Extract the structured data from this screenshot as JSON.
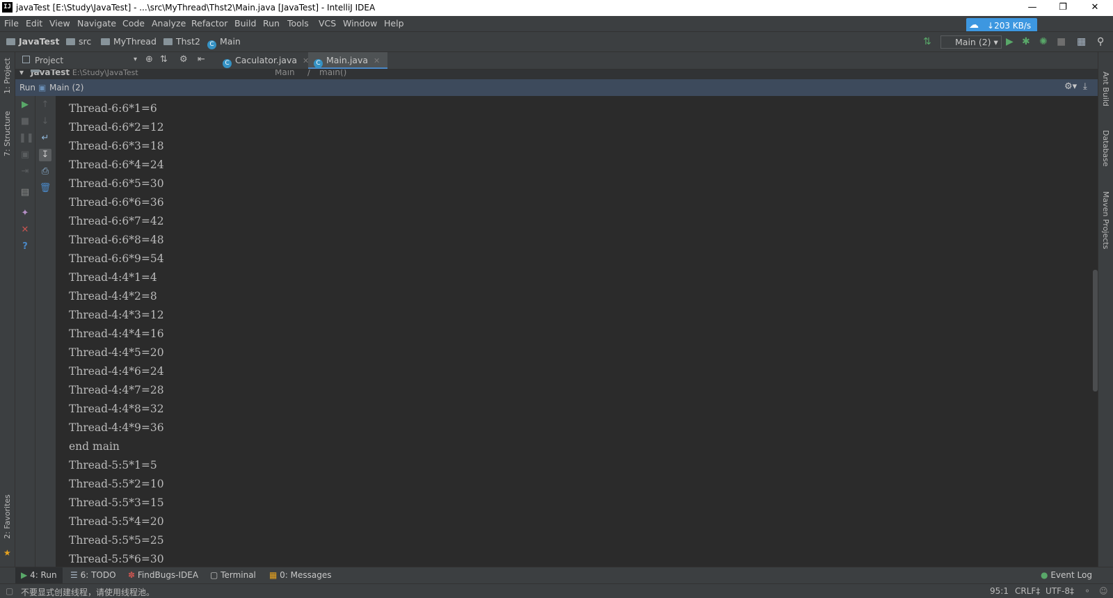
{
  "window": {
    "title": "javaTest [E:\\Study\\JavaTest] - ...\\src\\MyThread\\Thst2\\Main.java [JavaTest] - IntelliJ IDEA",
    "logo": "IJ",
    "controls": {
      "minimize_icon": "minimize-icon",
      "restore_icon": "restore-icon",
      "close_icon": "close-icon"
    }
  },
  "menu": [
    "File",
    "Edit",
    "View",
    "Navigate",
    "Code",
    "Analyze",
    "Refactor",
    "Build",
    "Run",
    "Tools",
    "VCS",
    "Window",
    "Help"
  ],
  "net_speed": {
    "value": "203 KB/s",
    "color": "#3d97e0"
  },
  "breadcrumb": [
    {
      "label": "JavaTest",
      "icon": "folder-icon"
    },
    {
      "label": "src",
      "icon": "folder-icon"
    },
    {
      "label": "MyThread",
      "icon": "folder-icon"
    },
    {
      "label": "Thst2",
      "icon": "folder-icon"
    },
    {
      "label": "Main",
      "icon": "class-icon"
    }
  ],
  "run_config": {
    "selected": "Main (2)"
  },
  "project_panel": {
    "title": "Project",
    "root_label": "JavaTest",
    "root_path": "E:\\Study\\JavaTest"
  },
  "editor_tabs": [
    {
      "label": "Caculator.java",
      "active": false
    },
    {
      "label": "Main.java",
      "active": true
    }
  ],
  "editor_breadcrumb": [
    "Main",
    "main()"
  ],
  "run_panel": {
    "label": "Run",
    "config": "Main (2)"
  },
  "console_lines": [
    "Thread-6:6*1=6",
    "Thread-6:6*2=12",
    "Thread-6:6*3=18",
    "Thread-6:6*4=24",
    "Thread-6:6*5=30",
    "Thread-6:6*6=36",
    "Thread-6:6*7=42",
    "Thread-6:6*8=48",
    "Thread-6:6*9=54",
    "Thread-4:4*1=4",
    "Thread-4:4*2=8",
    "Thread-4:4*3=12",
    "Thread-4:4*4=16",
    "Thread-4:4*5=20",
    "Thread-4:4*6=24",
    "Thread-4:4*7=28",
    "Thread-4:4*8=32",
    "Thread-4:4*9=36",
    "end main",
    "Thread-5:5*1=5",
    "Thread-5:5*2=10",
    "Thread-5:5*3=15",
    "Thread-5:5*4=20",
    "Thread-5:5*5=25",
    "Thread-5:5*6=30"
  ],
  "left_tool_windows": [
    "1: Project",
    "7: Structure",
    "2: Favorites"
  ],
  "right_tool_windows": [
    "Ant Build",
    "Database",
    "Maven Projects"
  ],
  "bottom_tabs": [
    {
      "label": "4: Run",
      "icon": "run-icon",
      "active": true
    },
    {
      "label": "6: TODO",
      "icon": "todo-icon",
      "active": false
    },
    {
      "label": "FindBugs-IDEA",
      "icon": "findbugs-icon",
      "active": false
    },
    {
      "label": "Terminal",
      "icon": "terminal-icon",
      "active": false
    },
    {
      "label": "0: Messages",
      "icon": "messages-icon",
      "active": false
    }
  ],
  "event_log": "Event Log",
  "status": {
    "message": "不要显式创建线程，请使用线程池。",
    "position": "95:1",
    "line_separator": "CRLF‡",
    "encoding": "UTF-8‡"
  }
}
